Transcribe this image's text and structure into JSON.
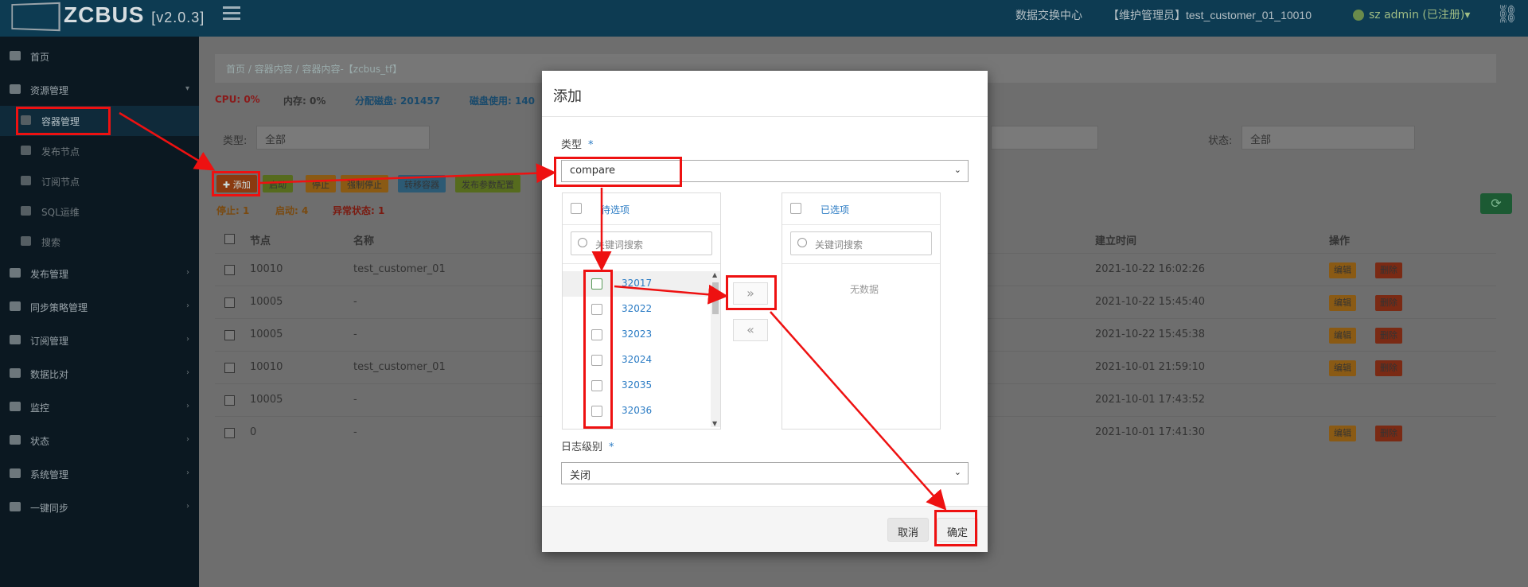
{
  "app": {
    "name": "ZCBUS",
    "version": "[v2.0.3]",
    "top_links": [
      "数据交换中心",
      "【维护管理员】test_customer_01_10010"
    ],
    "user": "sz admin (已注册)",
    "user_caret": "▾"
  },
  "sidebar": {
    "items": [
      {
        "label": "首页",
        "icon": "dashboard-icon"
      },
      {
        "label": "资源管理",
        "icon": "sitemap-icon",
        "arrow": "▾"
      },
      {
        "label": "容器管理",
        "icon": "container-icon"
      },
      {
        "label": "发布节点",
        "icon": "publish-node-icon"
      },
      {
        "label": "订阅节点",
        "icon": "subscribe-node-icon"
      },
      {
        "label": "SQL运维",
        "icon": "sql-icon"
      },
      {
        "label": "搜索",
        "icon": "search-icon"
      },
      {
        "label": "发布管理",
        "icon": "publish-icon",
        "arrow": "›"
      },
      {
        "label": "同步策略管理",
        "icon": "strategy-icon",
        "arrow": "›"
      },
      {
        "label": "订阅管理",
        "icon": "subscribe-icon",
        "arrow": "›"
      },
      {
        "label": "数据比对",
        "icon": "compare-icon",
        "arrow": "›"
      },
      {
        "label": "监控",
        "icon": "monitor-icon",
        "arrow": "›"
      },
      {
        "label": "状态",
        "icon": "status-icon",
        "arrow": "›"
      },
      {
        "label": "系统管理",
        "icon": "system-icon",
        "arrow": "›"
      },
      {
        "label": "一键同步",
        "icon": "sync-icon",
        "arrow": "›"
      }
    ]
  },
  "breadcrumb": [
    "首页",
    "/",
    "容器内容",
    "/",
    "容器内容-【zcbus_tf】"
  ],
  "stats": {
    "cpu": "CPU: 0%",
    "mem": "内存: 0%",
    "disk_alloc": "分配磁盘: 201457",
    "disk_used": "磁盘使用: 140"
  },
  "filters": {
    "type_label": "类型:",
    "type_value": "全部",
    "status_label": "状态:",
    "status_value": "全部"
  },
  "toolbar": {
    "add": "✚ 添加",
    "start": "启动",
    "stop": "停止",
    "force_stop": "强制停止",
    "move": "转移容器",
    "publish_param": "发布参数配置"
  },
  "status_counts": {
    "stopped": "停止: 1",
    "started": "启动: 4",
    "abnormal": "异常状态: 1"
  },
  "table": {
    "columns": [
      "节点",
      "名称",
      "建立时间",
      "操作"
    ],
    "rows": [
      {
        "node": "10010",
        "name": "test_customer_01",
        "time": "2021-10-22 16:02:26",
        "actions": true
      },
      {
        "node": "10005",
        "name": "-",
        "time": "2021-10-22 15:45:40",
        "actions": true
      },
      {
        "node": "10005",
        "name": "-",
        "time": "2021-10-22 15:45:38",
        "actions": true
      },
      {
        "node": "10010",
        "name": "test_customer_01",
        "time": "2021-10-01 21:59:10",
        "actions": true
      },
      {
        "node": "10005",
        "name": "-",
        "time": "2021-10-01 17:43:52",
        "actions": false
      },
      {
        "node": "0",
        "name": "-",
        "time": "2021-10-01 17:41:30",
        "actions": true
      }
    ],
    "edit_label": "编辑",
    "delete_label": "删除"
  },
  "modal": {
    "title": "添加",
    "type_label": "类型",
    "required_mark": "*",
    "type_value": "compare",
    "left_panel": {
      "title": "待选项",
      "search_placeholder": "关键词搜索",
      "items": [
        "32017",
        "32022",
        "32023",
        "32024",
        "32035",
        "32036"
      ]
    },
    "right_panel": {
      "title": "已选项",
      "search_placeholder": "关键词搜索",
      "empty": "无数据"
    },
    "move_right": "»",
    "move_left": "«",
    "log_label": "日志级别",
    "log_value": "关闭",
    "cancel": "取消",
    "confirm": "确定"
  },
  "colors": {
    "annotation": "#e11111",
    "link": "#2a7bc4",
    "topbar": "#0d3b52",
    "sidebar": "#0b1821"
  }
}
